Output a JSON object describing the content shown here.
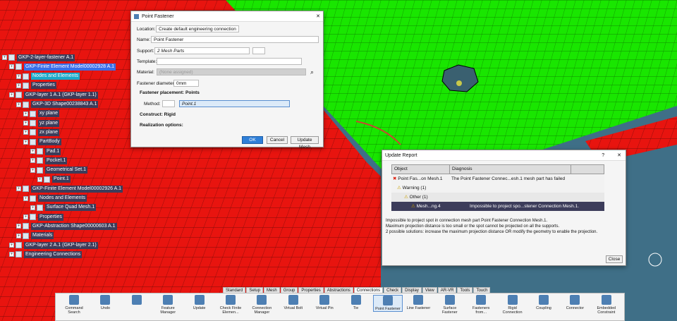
{
  "tree": {
    "items": [
      {
        "label": "GKP-2-layer-fastener A.1",
        "style": "normal"
      },
      {
        "label": "GKP-Finite Element Model00002928 A.1",
        "style": "sel"
      },
      {
        "label": "Nodes and Elements",
        "style": "hl"
      },
      {
        "label": "Properties",
        "style": "normal"
      },
      {
        "label": "GKP-layer 1 A.1 (GKP-layer 1.1)",
        "style": "normal"
      },
      {
        "label": "GKP-3D Shape00238843 A.1",
        "style": "normal"
      },
      {
        "label": "xy plane",
        "style": "normal"
      },
      {
        "label": "yz plane",
        "style": "normal"
      },
      {
        "label": "zx plane",
        "style": "normal"
      },
      {
        "label": "PartBody",
        "style": "normal"
      },
      {
        "label": "Pad.1",
        "style": "normal"
      },
      {
        "label": "Pocket.1",
        "style": "normal"
      },
      {
        "label": "Geometrical Set.1",
        "style": "normal"
      },
      {
        "label": "Point.1",
        "style": "normal"
      },
      {
        "label": "GKP-Finite Element Model00002926 A.1",
        "style": "normal"
      },
      {
        "label": "Nodes and Elements",
        "style": "normal"
      },
      {
        "label": "Surface Quad Mesh.1",
        "style": "normal"
      },
      {
        "label": "Properties",
        "style": "normal"
      },
      {
        "label": "GKP-Abstraction Shape00000603 A.1",
        "style": "normal"
      },
      {
        "label": "Materials",
        "style": "normal"
      },
      {
        "label": "GKP-layer 2 A.1 (GKP-layer 2.1)",
        "style": "normal"
      },
      {
        "label": "Engineering Connections",
        "style": "normal"
      }
    ]
  },
  "point_fastener": {
    "title": "Point Fastener",
    "location_label": "Location:",
    "location_value": "Create default engineering connection",
    "name_label": "Name:",
    "name_value": "Point Fastener",
    "support_label": "Support:",
    "support_value": "2 Mesh Parts",
    "template_label": "Template:",
    "material_label": "Material:",
    "material_placeholder": "(None assigned)",
    "diameter_label": "Fastener diameter:",
    "diameter_value": "0mm",
    "placement_header": "Fastener placement: Points",
    "method_label": "Method:",
    "method_value": "Point.1",
    "construct_header": "Construct: Rigid",
    "realization_header": "Realization options:",
    "ok": "OK",
    "cancel": "Cancel",
    "update_mesh": "Update Mesh"
  },
  "update_report": {
    "title": "Update Report",
    "col_object": "Object",
    "col_diagnosis": "Diagnosis",
    "rows": [
      {
        "object": "Point Fas...on Mesh.1",
        "diagnosis": "The Point Fastener Connec...esh.1 mesh part has failed"
      },
      {
        "object": "Warning (1)",
        "diagnosis": ""
      },
      {
        "object": "Other (1)",
        "diagnosis": ""
      },
      {
        "object": "Mesh...ng.4",
        "diagnosis": "Impossible to project spo...stener Connection Mesh.1."
      }
    ],
    "message_line1": "Impossible to project spot in connection mesh part Point Fastener Connection Mesh.1.",
    "message_line2": "Maximum projection distance is too small or the spot cannot be projected on all the supports.",
    "message_line3": "2 possible solutions: increase the maximum projection distance OR modify the geometry to enable the projection.",
    "close": "Close"
  },
  "tabs": [
    "Standard",
    "Setup",
    "Mesh",
    "Group",
    "Properties",
    "Abstractions",
    "Connections",
    "Check",
    "Display",
    "View",
    "AR-VR",
    "Tools",
    "Touch"
  ],
  "toolbar": [
    {
      "label": "Command Search"
    },
    {
      "label": "Undo"
    },
    {
      "label": ""
    },
    {
      "label": "Feature Manager"
    },
    {
      "label": "Update"
    },
    {
      "label": "Check Finite Elemen..."
    },
    {
      "label": "Connection Manager"
    },
    {
      "label": "Virtual Bolt"
    },
    {
      "label": "Virtual Pin"
    },
    {
      "label": "Tie"
    },
    {
      "label": "Point Fastener"
    },
    {
      "label": "Line Fastener"
    },
    {
      "label": "Surface Fastener"
    },
    {
      "label": "Fasteners from..."
    },
    {
      "label": "Rigid Connection"
    },
    {
      "label": "Coupling"
    },
    {
      "label": "Connector"
    },
    {
      "label": "Embedded Constraint"
    }
  ],
  "colors": {
    "red_mesh": "#e8140f",
    "green_mesh": "#19e600",
    "background": "#3f6f87",
    "accent": "#2f7fd8"
  }
}
